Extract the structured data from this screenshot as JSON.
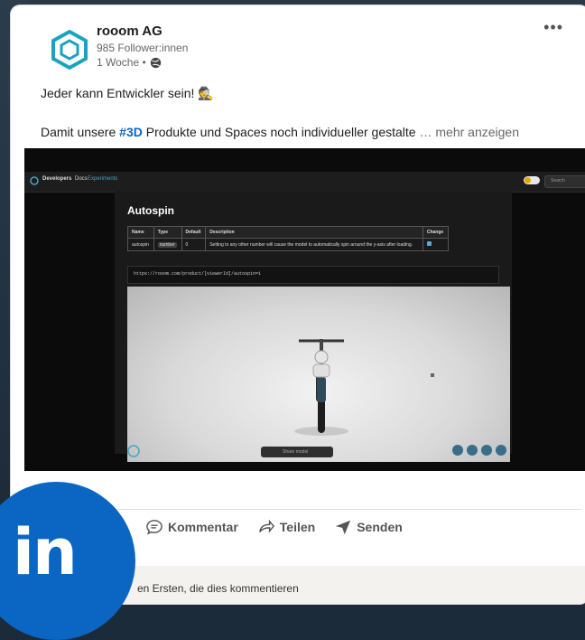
{
  "post": {
    "company": "rooom AG",
    "followers": "985 Follower:innen",
    "time": "1 Woche •",
    "line1": "Jeder kann Entwickler sein! 🕵",
    "line2_before": "Damit unsere ",
    "hashtag": "#3D",
    "line2_after": " Produkte und Spaces noch individueller gestalte",
    "more": " … mehr anzeigen",
    "more_menu": "•••"
  },
  "screenshot": {
    "brand": "Developers",
    "docs": "Docs",
    "experiments": "Experiments",
    "search": "Search",
    "heading": "Autospin",
    "table": {
      "headers": [
        "Name",
        "Type",
        "Default",
        "Description",
        "Change"
      ],
      "row": [
        "autospin",
        "number",
        "0",
        "Setting to any other number will cause the model to automatically spin around the y-axis after loading."
      ]
    },
    "code": "https://rooom.com/product/[viewerId]/autospin=1",
    "pill": "Share model"
  },
  "actions": {
    "comment": "Kommentar",
    "share": "Teilen",
    "send": "Senden"
  },
  "comments": {
    "prompt": "en Ersten, die dies kommentieren"
  },
  "badge": {
    "text": "in"
  },
  "colors": {
    "accent": "#0a66c2",
    "brand_teal": "#1aa3c0"
  }
}
